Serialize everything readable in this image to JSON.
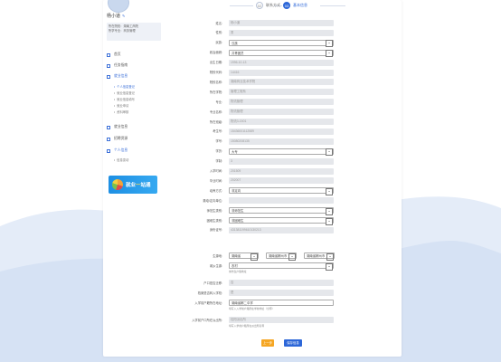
{
  "user": {
    "name": "杨小道",
    "name_icon": "edit-icon",
    "info": [
      "所在院校：湖南工商院",
      "所学专业：商务管理"
    ]
  },
  "nav": [
    {
      "label": "首页",
      "active": false
    },
    {
      "label": "任务指南",
      "active": false
    },
    {
      "label": "就业信息",
      "active": true
    }
  ],
  "subnav": [
    {
      "label": "个人信息登记",
      "active": true
    },
    {
      "label": "就业信息登记",
      "active": false
    },
    {
      "label": "就业信息填写",
      "active": false
    },
    {
      "label": "就业申请",
      "active": false
    },
    {
      "label": "资料审核",
      "active": false
    }
  ],
  "nav2": [
    {
      "label": "就业信息"
    },
    {
      "label": "招聘资源"
    },
    {
      "label": "个人信息"
    }
  ],
  "subnav2": [
    {
      "label": "信息变动"
    }
  ],
  "banner": {
    "prefix": "就业",
    "mid": "一",
    "suffix": "站通"
  },
  "steps": [
    {
      "num": "02",
      "label": "联系方式",
      "active": false
    },
    {
      "num": "03",
      "label": "基本信息",
      "active": true
    }
  ],
  "fields": [
    {
      "label": "姓名:",
      "value": "杨小道"
    },
    {
      "label": "性别:",
      "value": "男"
    },
    {
      "label": "民族:",
      "value": "汉族",
      "type": "select"
    },
    {
      "label": "政治面貌:",
      "value": "共青团员",
      "type": "select"
    },
    {
      "label": "出生日期:",
      "value": "1996-10-13"
    },
    {
      "label": "院校代码:",
      "value": "14416"
    },
    {
      "label": "院校名称:",
      "value": "湖南商业技术学院"
    },
    {
      "label": "所在学院:",
      "value": "管理工程系"
    },
    {
      "label": "专业:",
      "value": "物流管理"
    },
    {
      "label": "专业名称:",
      "value": "物流管理"
    },
    {
      "label": "所在班级:",
      "value": "物流3-1501"
    },
    {
      "label": "考生号:",
      "value": "15436001112589"
    },
    {
      "label": "学号:",
      "value": "15080208135"
    },
    {
      "label": "学历:",
      "value": "大专",
      "type": "select"
    },
    {
      "label": "学制:",
      "value": "3"
    },
    {
      "label": "入学时间:",
      "value": "201509"
    },
    {
      "label": "毕业时间:",
      "value": "202007"
    },
    {
      "label": "培养方式:",
      "value": "非定向",
      "type": "select"
    },
    {
      "label": "委培/定向单位:",
      "value": ""
    },
    {
      "label": "师范生类别:",
      "value": "非师范生",
      "type": "select"
    },
    {
      "label": "困难生类别:",
      "value": "非困难生",
      "type": "select"
    },
    {
      "label": "身份证号:",
      "value": "431381199610130213"
    }
  ],
  "birthplace": {
    "label": "生源地:",
    "province": "湖南省",
    "city": "湖南省郴州市",
    "county": "湖南省郴州市"
  },
  "hukou": {
    "label": "城乡生源:",
    "value": "农村",
    "hint": "城市生户籍地址"
  },
  "grad": {
    "label": "户口是否迁移:",
    "value": "否"
  },
  "school_move": {
    "label": "档案是否转入学校:",
    "value": "是"
  },
  "addr1": {
    "label": "入学前户籍所在地址:",
    "value": "湖南省郴二中学",
    "hint": "填写入入学前户籍所在学校地址（全称）"
  },
  "addr2": {
    "label": "入学前户口所在派出所:",
    "value": "桂阳派出所",
    "hint": "填写入学前户籍所在派出所名称"
  },
  "buttons": {
    "prev": "上一步",
    "save": "保存信息"
  }
}
